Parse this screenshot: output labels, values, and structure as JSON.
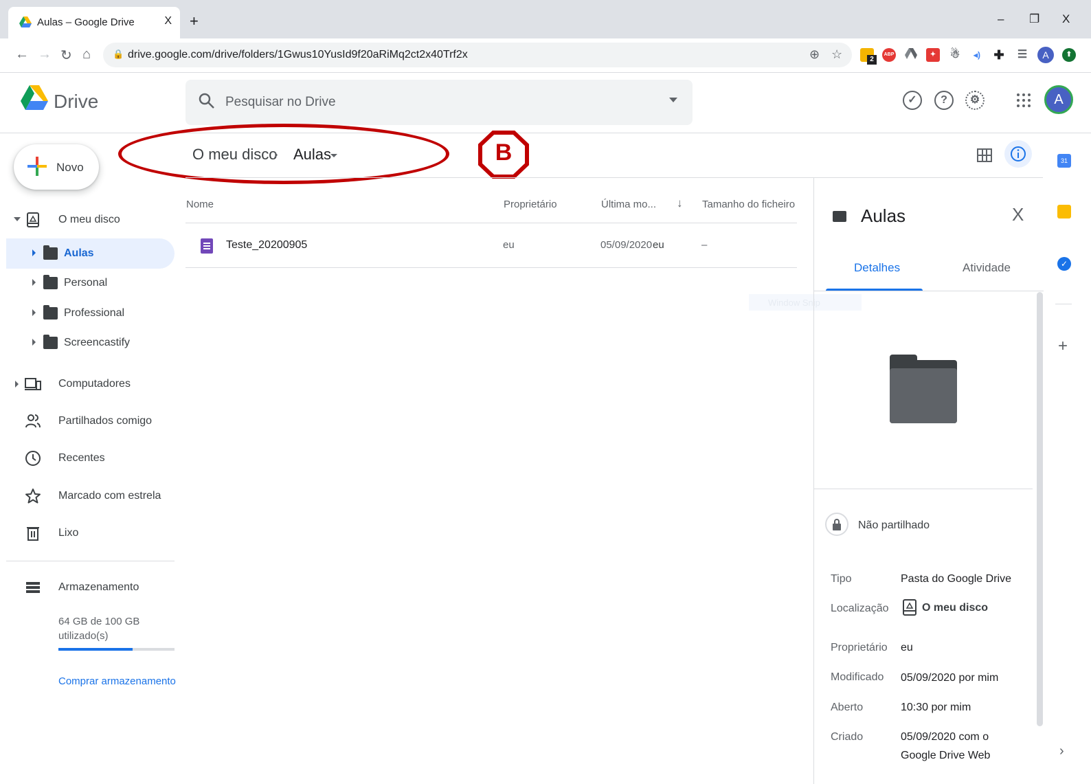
{
  "browser": {
    "tab_title": "Aulas – Google Drive",
    "tab_close": "X",
    "new_tab": "+",
    "url": "drive.google.com/drive/folders/1Gwus10YusId9f20aRiMq2ct2x40Trf2x",
    "ext_badge_count": "2",
    "ext_abp": "ABP",
    "profile_initial": "A",
    "window_controls": {
      "minimize": "–",
      "restore": "❐",
      "close": "X"
    }
  },
  "drive": {
    "product_name": "Drive",
    "search_placeholder": "Pesquisar no Drive",
    "account_initial": "A"
  },
  "sidebar": {
    "new_label": "Novo",
    "my_drive": "O meu disco",
    "folders": [
      {
        "label": "Aulas",
        "active": true
      },
      {
        "label": "Personal",
        "active": false
      },
      {
        "label": "Professional",
        "active": false
      },
      {
        "label": "Screencastify",
        "active": false
      }
    ],
    "computers": "Computadores",
    "shared": "Partilhados comigo",
    "recent": "Recentes",
    "starred": "Marcado com estrela",
    "trash": "Lixo",
    "storage": "Armazenamento",
    "storage_used": "64 GB de 100 GB utilizado(s)",
    "storage_fraction": 0.64,
    "buy_storage": "Comprar armazenamento"
  },
  "breadcrumb": {
    "root": "O meu disco",
    "separator": "›",
    "current": "Aulas"
  },
  "annotation_label": "B",
  "table": {
    "columns": [
      "Nome",
      "Proprietário",
      "Última mo...",
      "Tamanho do ficheiro"
    ],
    "rows": [
      {
        "name": "Teste_20200905",
        "owner": "eu",
        "modified": "05/09/2020",
        "modified_by": "eu",
        "size": "–"
      }
    ]
  },
  "overlay_text": "Window Snip",
  "details": {
    "title": "Aulas",
    "close": "X",
    "tab_details": "Detalhes",
    "tab_activity": "Atividade",
    "sharing": "Não partilhado",
    "fields": {
      "type_label": "Tipo",
      "type_value": "Pasta do Google Drive",
      "location_label": "Localização",
      "location_value": "O meu disco",
      "owner_label": "Proprietário",
      "owner_value": "eu",
      "modified_label": "Modificado",
      "modified_value": "05/09/2020 por mim",
      "opened_label": "Aberto",
      "opened_value": "10:30 por mim",
      "created_label": "Criado",
      "created_value": "05/09/2020 com o Google Drive Web"
    }
  },
  "rail": {
    "add": "+",
    "expand": "›",
    "calendar_day": "31"
  },
  "colors": {
    "accent": "#1a73e8",
    "annotation": "#c00000",
    "active_bg": "#e8f0fe"
  }
}
